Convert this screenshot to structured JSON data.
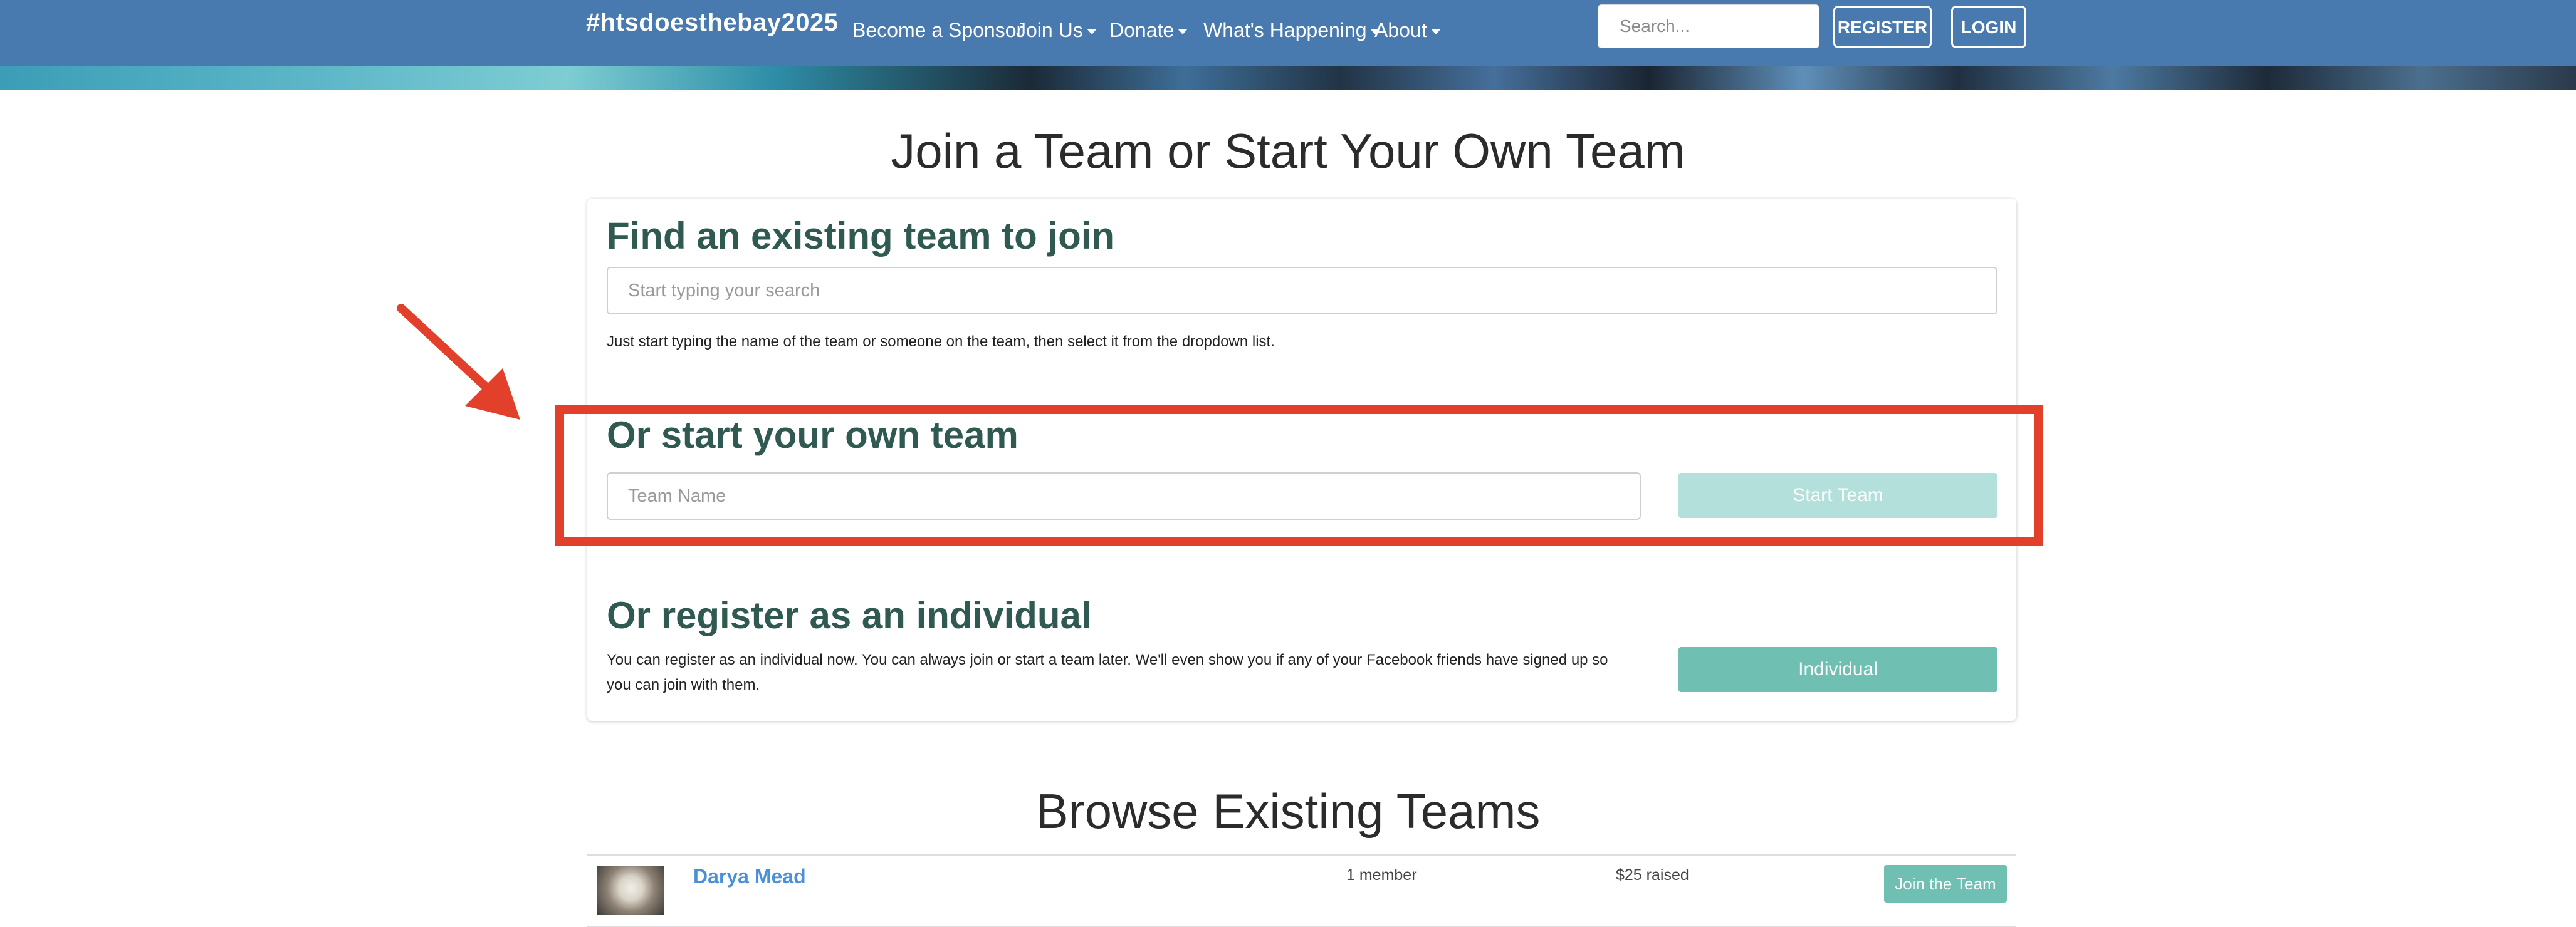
{
  "navbar": {
    "brand": "#htsdoesthebay2025",
    "items": [
      {
        "label": "Become a Sponsor",
        "has_caret": false
      },
      {
        "label": "Join Us",
        "has_caret": true
      },
      {
        "label": "Donate",
        "has_caret": true
      },
      {
        "label": "What's Happening",
        "has_caret": true
      },
      {
        "label": "About",
        "has_caret": true
      }
    ],
    "search_placeholder": "Search...",
    "register_label": "REGISTER",
    "login_label": "LOGIN"
  },
  "page": {
    "heading": "Join a Team or Start Your Own Team"
  },
  "find_team": {
    "title": "Find an existing team to join",
    "search_placeholder": "Start typing your search",
    "help": "Just start typing the name of the team or someone on the team, then select it from the dropdown list."
  },
  "start_team": {
    "title": "Or start your own team",
    "name_placeholder": "Team Name",
    "button_label": "Start Team"
  },
  "individual": {
    "title": "Or register as an individual",
    "description": "You can register as an individual now. You can always join or start a team later. We'll even show you if any of your Facebook friends have signed up so you can join with them.",
    "button_label": "Individual"
  },
  "browse": {
    "heading": "Browse Existing Teams",
    "teams": [
      {
        "name": "Darya Mead",
        "members": "1 member",
        "raised": "$25 raised",
        "join_label": "Join the Team"
      }
    ]
  },
  "colors": {
    "navbar": "#487ab0",
    "section_title": "#305a51",
    "teal_button": "#6fc0b2",
    "teal_button_disabled": "#b4e0db",
    "highlight": "#e3402b",
    "link": "#4a90d9"
  },
  "icons": {
    "caret": "caret-down-icon",
    "annotation_arrow": "arrow-icon"
  }
}
